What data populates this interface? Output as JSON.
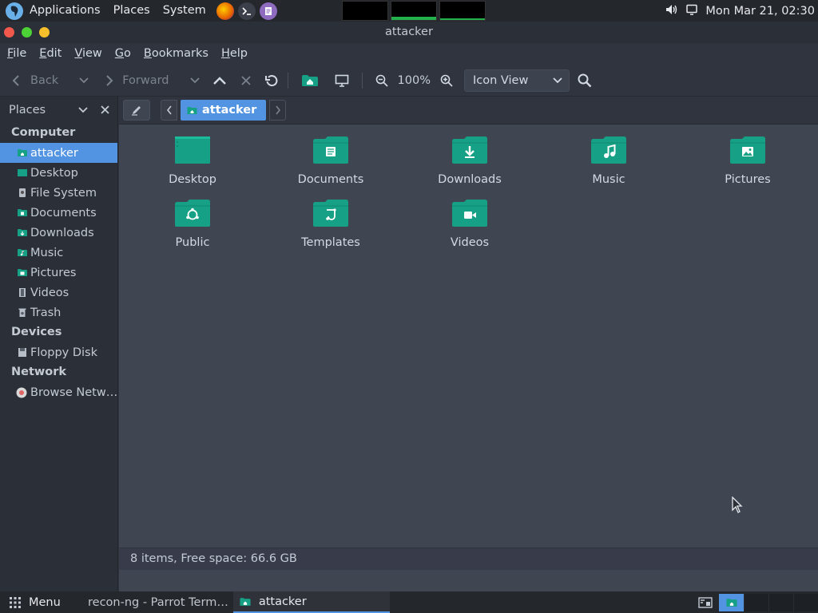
{
  "panel": {
    "menus": [
      "Applications",
      "Places",
      "System"
    ],
    "clock": "Mon Mar 21, 02:30"
  },
  "window": {
    "title": "attacker"
  },
  "menubar": [
    "File",
    "Edit",
    "View",
    "Go",
    "Bookmarks",
    "Help"
  ],
  "toolbar": {
    "back_label": "Back",
    "forward_label": "Forward",
    "zoom": "100%",
    "view_mode": "Icon View"
  },
  "sidebar": {
    "header": "Places",
    "sections": [
      {
        "title": "Computer",
        "items": [
          {
            "label": "attacker",
            "icon": "home-folder-icon",
            "selected": true
          },
          {
            "label": "Desktop",
            "icon": "desktop-icon"
          },
          {
            "label": "File System",
            "icon": "drive-icon"
          },
          {
            "label": "Documents",
            "icon": "folder-documents-icon"
          },
          {
            "label": "Downloads",
            "icon": "folder-downloads-icon"
          },
          {
            "label": "Music",
            "icon": "folder-music-icon"
          },
          {
            "label": "Pictures",
            "icon": "folder-pictures-icon"
          },
          {
            "label": "Videos",
            "icon": "film-icon"
          },
          {
            "label": "Trash",
            "icon": "trash-icon"
          }
        ]
      },
      {
        "title": "Devices",
        "items": [
          {
            "label": "Floppy Disk",
            "icon": "floppy-icon"
          }
        ]
      },
      {
        "title": "Network",
        "items": [
          {
            "label": "Browse Netw…",
            "icon": "network-icon"
          }
        ]
      }
    ]
  },
  "pathbar": {
    "crumb": "attacker"
  },
  "files": [
    {
      "name": "Desktop",
      "icon": "desktop-folder-icon"
    },
    {
      "name": "Documents",
      "icon": "documents-folder-icon"
    },
    {
      "name": "Downloads",
      "icon": "downloads-folder-icon"
    },
    {
      "name": "Music",
      "icon": "music-folder-icon"
    },
    {
      "name": "Pictures",
      "icon": "pictures-folder-icon"
    },
    {
      "name": "Public",
      "icon": "public-folder-icon"
    },
    {
      "name": "Templates",
      "icon": "templates-folder-icon"
    },
    {
      "name": "Videos",
      "icon": "videos-folder-icon"
    }
  ],
  "status": "8 items, Free space: 66.6 GB",
  "taskbar": {
    "menu_label": "Menu",
    "tasks": [
      {
        "label": "recon-ng - Parrot Term…",
        "icon": "terminal-icon",
        "active": false
      },
      {
        "label": "attacker",
        "icon": "home-folder-icon",
        "active": true
      }
    ]
  },
  "colors": {
    "accent": "#5294e2",
    "folder": "#16a085",
    "folder_dark": "#0e8a70"
  }
}
